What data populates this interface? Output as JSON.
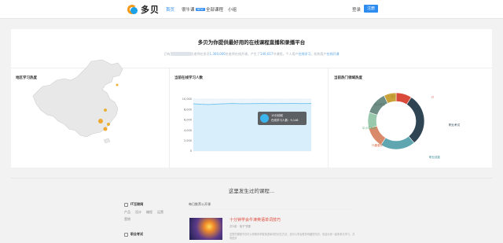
{
  "nav": {
    "logo_text": "多贝",
    "items": [
      {
        "label": "首页",
        "active": true
      },
      {
        "label": "很牛课",
        "badge": "NEW"
      },
      {
        "label": "全部课程"
      },
      {
        "label": "小组"
      }
    ],
    "login": "登录",
    "register": "注册"
  },
  "hero": {
    "title": "多贝为你提供最好用的在线课程直播和录播平台",
    "sub_prefix": "已有",
    "sub_a": "位老师在多贝",
    "sub_count_courses": "1,300,000",
    "sub_b": "名老师在线开课",
    "sub_c": "，产生了",
    "sub_count_students": "140,617",
    "sub_d": "节课程，个人用户",
    "sub_link1": "在线学习",
    "sub_e": "，机构用户",
    "sub_link2": "在线开课"
  },
  "sections": {
    "map_title": "地区学习热度",
    "line_title": "当前在线学习人数",
    "donut_title": "当前热门领域热度"
  },
  "chart_data": [
    {
      "type": "line",
      "title": "当前在线学习人数",
      "y_ticks": [
        "10,000",
        "8,000",
        "6,000",
        "4,000",
        "2,000",
        "0"
      ],
      "ylim": [
        0,
        10000
      ],
      "series": [
        {
          "values": [
            9100,
            9000,
            8950,
            9050,
            9100,
            9150,
            9100,
            9120,
            9130,
            9146,
            9140,
            9135,
            9150,
            9145,
            9140,
            9146
          ]
        }
      ],
      "tooltip": {
        "time": "10分钟前",
        "label": "在线学习人数：9,146"
      }
    },
    {
      "type": "pie",
      "title": "当前热门领域热度",
      "slices": [
        {
          "label": "IT",
          "value": 9,
          "color": "#d94a3a"
        },
        {
          "label": "职业考试",
          "value": 30,
          "color": "#2f4553"
        },
        {
          "label": "职业技能",
          "value": 20,
          "color": "#5fa6b0"
        },
        {
          "label": "兴趣爱好",
          "value": 12,
          "color": "#d98a6a"
        },
        {
          "label": "中小学教育",
          "value": 9,
          "color": "#98c9ac"
        },
        {
          "label": "成人教育",
          "value": 13,
          "color": "#6f8f86"
        },
        {
          "label": "语言",
          "value": 7,
          "color": "#c9a23a"
        }
      ]
    }
  ],
  "lower": {
    "title": "这里发生过的课程...",
    "cat1": {
      "head": "IT互联网",
      "links": [
        "产品",
        "设计",
        "编程",
        "运营",
        "营销"
      ]
    },
    "cat2": {
      "head": "职业考试"
    },
    "list_head": "每日推荐公开课",
    "course": {
      "title": "十分钟学会牛津英语单词技巧",
      "meta": "共5讲  ·  电子书课",
      "desc": "这里的课程不仅可以帮助你掌握英语单词的记忆方法，还可以学会很多有趣的知识，欢迎大家一起来参与学习，共同进步"
    }
  }
}
